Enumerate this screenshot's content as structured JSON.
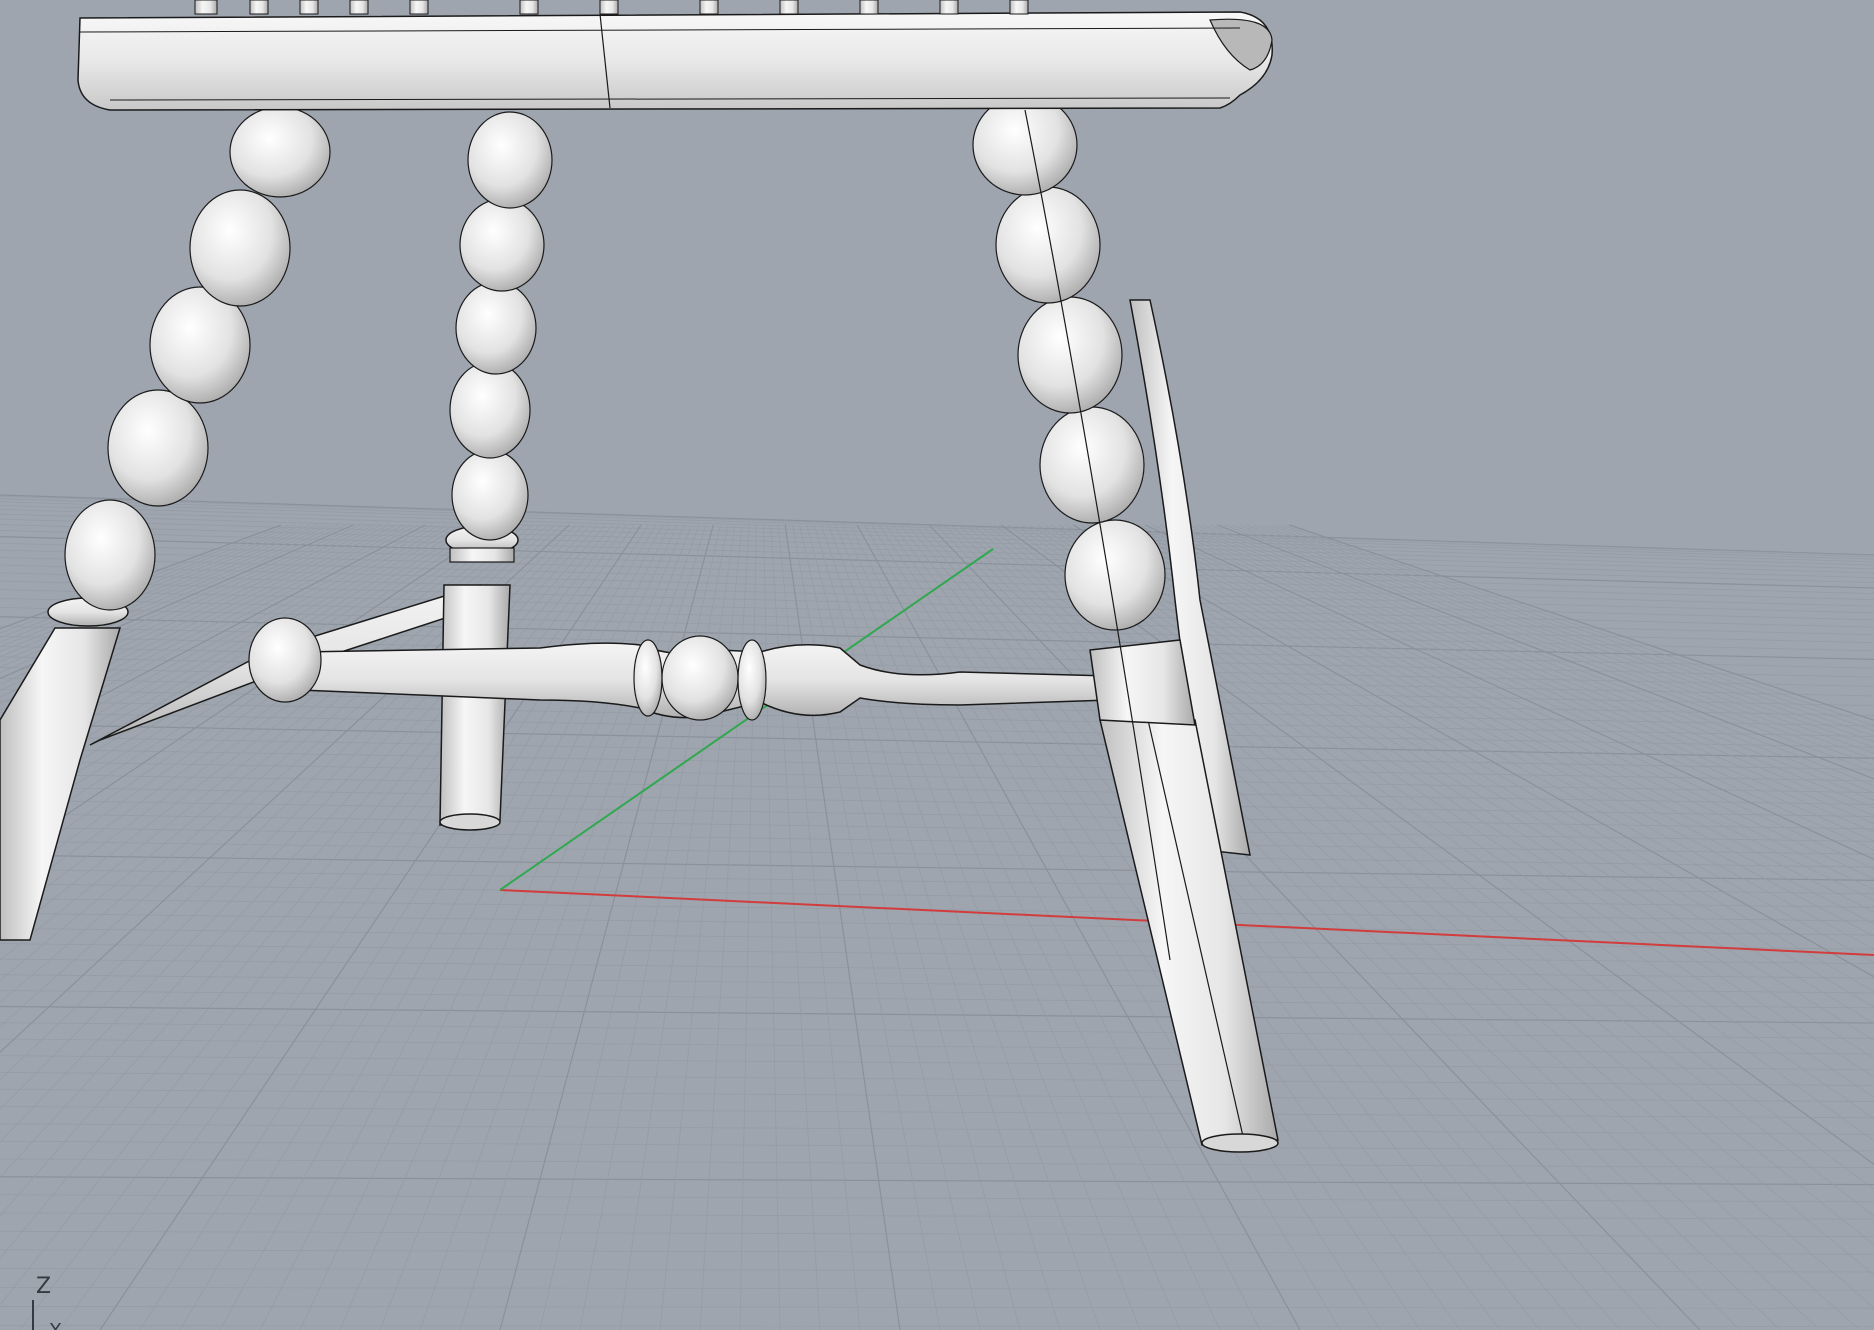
{
  "viewport": {
    "background_color": "#9ea5ae",
    "grid_minor_color": "#959ca5",
    "grid_major_color": "#8a919a",
    "x_axis_color": "#d23c3c",
    "y_axis_color": "#2fa84f",
    "model_color": "#ededed",
    "edge_color": "#1a1a1a"
  },
  "axis_widget": {
    "z_label": "Z",
    "y_label": "Y"
  },
  "icons": {
    "axis_widget": "world-axes-icon"
  }
}
